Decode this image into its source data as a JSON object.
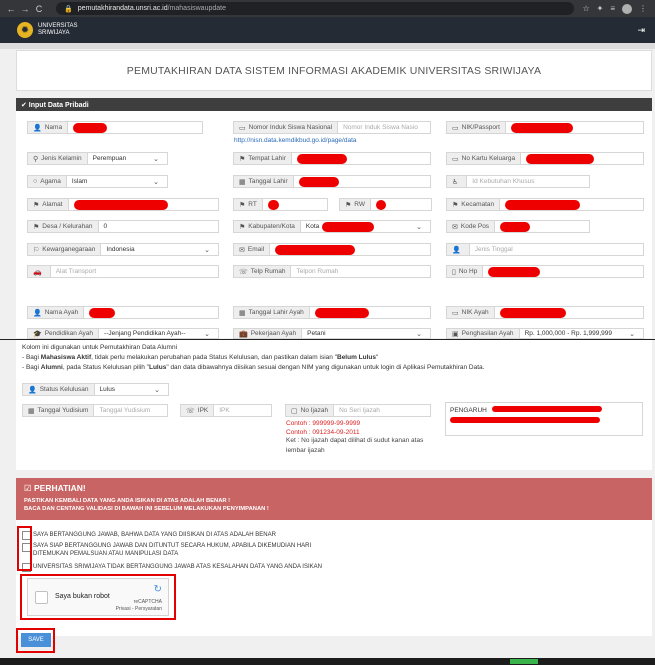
{
  "browser": {
    "back": "←",
    "forward": "→",
    "reload": "C",
    "url_host": "pemutakhirandata.unsri.ac.id",
    "url_path": "/mahasiswaupdate"
  },
  "app": {
    "logo_glyph": "✹",
    "name_line1": "UNIVERSITAS",
    "name_line2": "SRIWIJAYA",
    "logout_glyph": "⇥"
  },
  "page_title": "PEMUTAKHIRAN DATA SISTEM INFORMASI AKADEMIK UNIVERSITAS SRIWIJAYA",
  "section_title": "✔ Input Data Pribadi",
  "form": {
    "nama": {
      "label": "Nama",
      "icon": "user-icon"
    },
    "nisn": {
      "label": "Nomor Induk Siswa Nasional",
      "placeholder": "Nomor Induk Siswa Nasio",
      "icon": "id-card-icon"
    },
    "nisn_link": "http://nisn.data.kemdikbud.go.id/page/data",
    "nik": {
      "label": "NIK/Passport",
      "icon": "id-card-icon"
    },
    "jenis_kelamin": {
      "label": "Jenis Kelamin",
      "value": "Perempuan",
      "icon": "gender-icon"
    },
    "tempat_lahir": {
      "label": "Tempat Lahir",
      "icon": "map-marker-icon"
    },
    "no_kk": {
      "label": "No Kartu Keluarga",
      "icon": "id-card-icon"
    },
    "agama": {
      "label": "Agama",
      "value": "Islam",
      "icon": "circle-icon"
    },
    "tanggal_lahir": {
      "label": "Tanggal Lahir",
      "icon": "calendar-icon"
    },
    "kebutuhan_khusus": {
      "placeholder": "Id Kebutuhan Khusus",
      "icon": "accessibility-icon"
    },
    "alamat": {
      "label": "Alamat",
      "icon": "map-marker-icon"
    },
    "rt": {
      "label": "RT",
      "icon": "map-marker-icon"
    },
    "rw": {
      "label": "RW",
      "icon": "map-marker-icon"
    },
    "kecamatan": {
      "label": "Kecamatan",
      "icon": "map-marker-icon"
    },
    "desa": {
      "label": "Desa / Kelurahan",
      "value": "0",
      "icon": "map-marker-icon"
    },
    "kabupaten": {
      "label": "Kabupaten/Kota",
      "value": "Kota",
      "icon": "map-marker-icon"
    },
    "kode_pos": {
      "label": "Kode Pos",
      "icon": "envelope-icon"
    },
    "kewarganegaraan": {
      "label": "Kewarganegaraan",
      "value": "Indonesia",
      "icon": "flag-icon"
    },
    "email": {
      "label": "Email",
      "icon": "envelope-icon"
    },
    "jenis_tinggal": {
      "placeholder": "Jenis Tinggal",
      "icon": "user-icon"
    },
    "alat_transport": {
      "placeholder": "Alat Transport",
      "icon": "car-icon"
    },
    "telp_rumah": {
      "label": "Telp Rumah",
      "placeholder": "Telpon Rumah",
      "icon": "phone-icon"
    },
    "no_hp": {
      "label": "No Hp",
      "icon": "mobile-icon"
    },
    "nama_ayah": {
      "label": "Nama Ayah",
      "icon": "user-icon"
    },
    "tgl_lahir_ayah": {
      "label": "Tanggal Lahir Ayah",
      "icon": "calendar-icon"
    },
    "nik_ayah": {
      "label": "NIK Ayah",
      "icon": "id-card-icon"
    },
    "pendidikan_ayah": {
      "label": "Pendidikan Ayah",
      "value": "--Jenjang Pendidikan Ayah--",
      "icon": "graduation-cap-icon"
    },
    "pekerjaan_ayah": {
      "label": "Pekerjaan Ayah",
      "value": "Petani",
      "icon": "briefcase-icon"
    },
    "penghasilan_ayah": {
      "label": "Penghasilan Ayah",
      "value": "Rp. 1,000,000 - Rp. 1,999,999",
      "icon": "money-icon"
    }
  },
  "alumni": {
    "line1": "Kolom ini digunakan untuk Pemutakhiran Data Alumni",
    "line2_pre": " - Bagi ",
    "line2_bold": "Mahasiswa Aktif",
    "line2_mid": ", tidak perlu melakukan perubahan pada Status Kelulusan, dan pastikan dalam isian \"",
    "line2_bold2": "Belum Lulus",
    "line2_end": "\"",
    "line3_pre": " - Bagi ",
    "line3_bold": "Alumni",
    "line3_mid": ", pada Status Kelulusan pilih \"",
    "line3_bold2": "Lulus",
    "line3_end": "\" dan data dibawahnya diisikan sesuai dengan NIM yang digunakan untuk login di Aplikasi Pemutakhiran Data.",
    "status": {
      "label": "Status Kelulusan",
      "value": "Lulus",
      "icon": "user-icon"
    },
    "tanggal_yudisium": {
      "label": "Tanggal Yudisium",
      "placeholder": "Tanggal Yudisium",
      "icon": "calendar-icon"
    },
    "ipk": {
      "label": "IPK",
      "placeholder": "IPK",
      "icon": "phone-icon"
    },
    "no_ijazah": {
      "label": "No Ijazah",
      "placeholder": "No Seri Ijazah",
      "icon": "file-icon"
    },
    "contoh1": "Contoh : 999999-99-9999",
    "contoh2": "Contoh : 091234-09-2011",
    "ket1": "Ket : No ijazah dapat dilihat di sudut kanan atas",
    "ket2": "lembar ijazah",
    "pengaruh": "PENGARUH"
  },
  "warning": {
    "title": "☑ PERHATIAN!",
    "line1": "PASTIKAN KEMBALI DATA YANG ANDA ISIKAN DI ATAS ADALAH BENAR !",
    "line2": "BACA DAN CENTANG VALIDASI DI BAWAH INI SEBELUM MELAKUKAN PENYIMPANAN !"
  },
  "checks": [
    "SAYA BERTANGGUNG JAWAB, BAHWA DATA YANG DIISIKAN DI ATAS ADALAH BENAR",
    "SAYA SIAP BERTANGGUNG JAWAB DAN DITUNTUT SECARA HUKUM, APABILA DIKEMUDIAN HARI",
    "DITEMUKAN PEMALSUAN ATAU MANIPULASI DATA",
    "UNIVERSITAS SRIWIJAYA TIDAK BERTANGGUNG JAWAB ATAS KESALAHAN DATA YANG ANDA ISIKAN"
  ],
  "captcha": {
    "text": "Saya bukan robot",
    "brand": "reCAPTCHA",
    "links": "Privasi - Persyaratan"
  },
  "save_label": "SAVE",
  "colors": {
    "redaction": "#ef0000",
    "highlight": "#e30000",
    "warning_bg": "#c96464",
    "save_bg": "#4a90d9"
  }
}
